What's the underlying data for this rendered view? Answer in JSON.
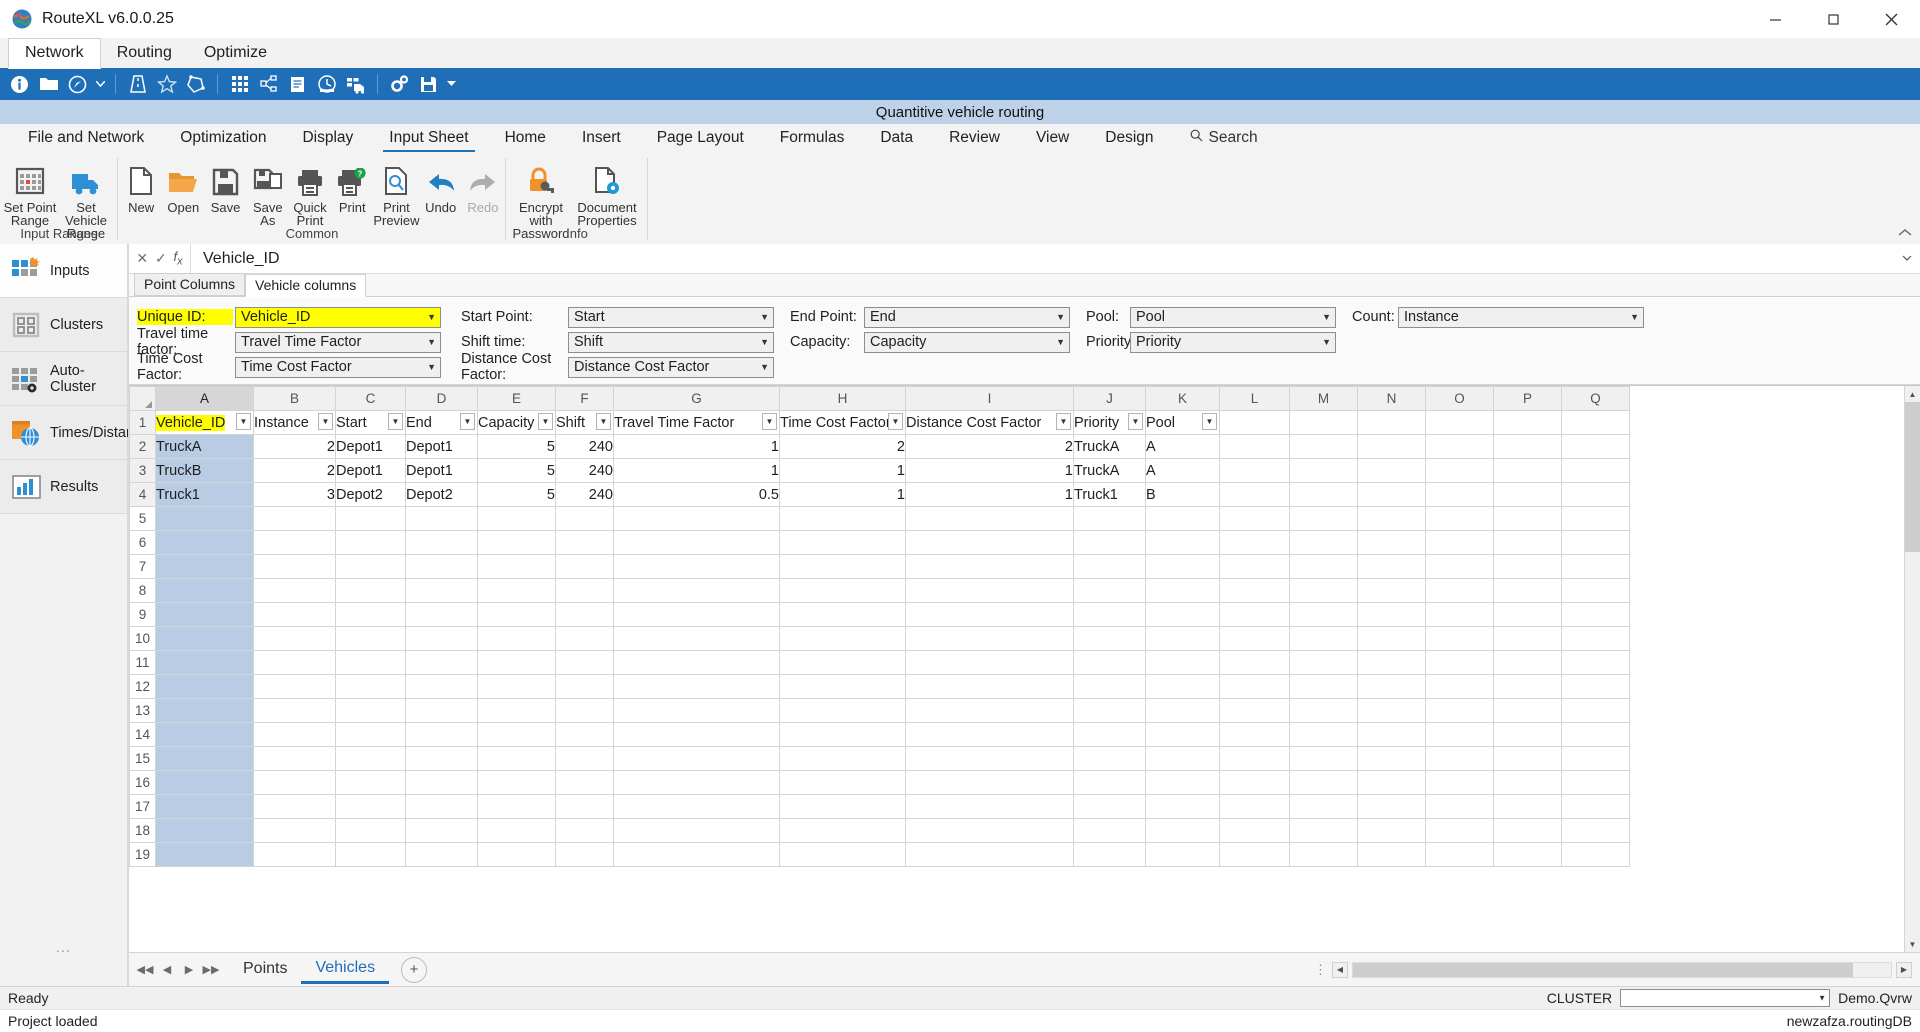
{
  "window": {
    "title": "RouteXL v6.0.0.25",
    "icon": "app-globe-icon",
    "minimize": "minimize",
    "maximize": "maximize",
    "close": "close"
  },
  "menubar": {
    "items": [
      {
        "label": "Network",
        "active": true
      },
      {
        "label": "Routing",
        "active": false
      },
      {
        "label": "Optimize",
        "active": false
      }
    ]
  },
  "quickbar": {
    "icons": [
      "info-icon",
      "folder-icon",
      "compass-icon",
      "chevron-down-icon",
      "road-icon",
      "star-icon",
      "polygon-icon",
      "matrix-icon",
      "network-nodes-icon",
      "report-icon",
      "clock-icon",
      "truck-list-icon",
      "settings-gears-icon",
      "save-icon",
      "chevron-down-icon"
    ]
  },
  "document": {
    "band_title": "Quantitive vehicle routing"
  },
  "ribbon": {
    "tabs": [
      {
        "label": "File and Network",
        "active": false
      },
      {
        "label": "Optimization",
        "active": false
      },
      {
        "label": "Display",
        "active": false
      },
      {
        "label": "Input Sheet",
        "active": true
      },
      {
        "label": "Home",
        "active": false
      },
      {
        "label": "Insert",
        "active": false
      },
      {
        "label": "Page Layout",
        "active": false
      },
      {
        "label": "Formulas",
        "active": false
      },
      {
        "label": "Data",
        "active": false
      },
      {
        "label": "Review",
        "active": false
      },
      {
        "label": "View",
        "active": false
      },
      {
        "label": "Design",
        "active": false
      }
    ],
    "search": {
      "label": "Search",
      "icon": "search-icon"
    },
    "groups": [
      {
        "name": "Input Ranges",
        "commands": [
          {
            "label": "Set Point\nRange",
            "icon": "point-range-grid-icon",
            "disabled": false
          },
          {
            "label": "Set Vehicle\nRange",
            "icon": "truck-icon",
            "disabled": false
          }
        ]
      },
      {
        "name": "Common",
        "commands": [
          {
            "label": "New",
            "icon": "new-document-icon",
            "disabled": false
          },
          {
            "label": "Open",
            "icon": "open-folder-icon",
            "disabled": false
          },
          {
            "label": "Save",
            "icon": "floppy-save-icon",
            "disabled": false
          },
          {
            "label": "Save As",
            "icon": "save-as-icon",
            "disabled": false
          },
          {
            "label": "Quick\nPrint",
            "icon": "quick-print-icon",
            "disabled": false
          },
          {
            "label": "Print",
            "icon": "print-help-icon",
            "disabled": false
          },
          {
            "label": "Print\nPreview",
            "icon": "print-preview-icon",
            "disabled": false
          },
          {
            "label": "Undo",
            "icon": "undo-arrow-icon",
            "disabled": false
          },
          {
            "label": "Redo",
            "icon": "redo-arrow-icon",
            "disabled": true
          }
        ]
      },
      {
        "name": "Info",
        "commands": [
          {
            "label": "Encrypt with\nPassword",
            "icon": "padlock-key-icon",
            "disabled": false
          },
          {
            "label": "Document\nProperties",
            "icon": "document-gear-icon",
            "disabled": false
          }
        ]
      }
    ],
    "collapse_icon": "chevron-up-icon"
  },
  "sidebar": {
    "items": [
      {
        "label": "Inputs",
        "icon": "inputs-grid-icon",
        "active": true
      },
      {
        "label": "Clusters",
        "icon": "clusters-grid-icon",
        "active": false
      },
      {
        "label": "Auto-Cluster",
        "icon": "auto-cluster-icon",
        "active": false
      },
      {
        "label": "Times/Distances",
        "icon": "times-distances-globe-icon",
        "active": false
      },
      {
        "label": "Results",
        "icon": "results-chart-icon",
        "active": false
      }
    ],
    "overflow": "..."
  },
  "formula_bar": {
    "cancel_icon": "cancel-x-icon",
    "confirm_icon": "confirm-check-icon",
    "function_icon": "fx-icon",
    "value": "Vehicle_ID",
    "expand_icon": "chevron-down-icon"
  },
  "column_tabs": [
    {
      "label": "Point Columns",
      "active": false
    },
    {
      "label": "Vehicle columns",
      "active": true
    }
  ],
  "mapping_form": {
    "fields": [
      {
        "label": "Unique ID:",
        "value": "Vehicle_ID",
        "highlighted": true,
        "type": "combo"
      },
      {
        "label": "Start Point:",
        "value": "Start",
        "highlighted": false,
        "type": "combo"
      },
      {
        "label": "End Point:",
        "value": "End",
        "highlighted": false,
        "type": "combo"
      },
      {
        "label": "Pool:",
        "value": "Pool",
        "highlighted": false,
        "type": "combo"
      },
      {
        "label": "Count:",
        "value": "Instance",
        "highlighted": false,
        "type": "combo"
      },
      {
        "label": "Travel time factor:",
        "value": "Travel Time Factor",
        "highlighted": false,
        "type": "combo"
      },
      {
        "label": "Shift time:",
        "value": "Shift",
        "highlighted": false,
        "type": "combo"
      },
      {
        "label": "Capacity:",
        "value": "Capacity",
        "highlighted": false,
        "type": "combo"
      },
      {
        "label": "Priority",
        "value": "Priority",
        "highlighted": false,
        "type": "combo"
      },
      {
        "label": "Time Cost Factor:",
        "value": "Time Cost Factor",
        "highlighted": false,
        "type": "combo"
      },
      {
        "label": "Distance Cost Factor:",
        "value": "Distance Cost Factor",
        "highlighted": false,
        "type": "combo"
      }
    ]
  },
  "sheet": {
    "column_letters": [
      "A",
      "B",
      "C",
      "D",
      "E",
      "F",
      "G",
      "H",
      "I",
      "J",
      "K",
      "L",
      "M",
      "N",
      "O",
      "P",
      "Q"
    ],
    "headers": [
      "Vehicle_ID",
      "Instance",
      "Start",
      "End",
      "Capacity",
      "Shift",
      "Travel Time Factor",
      "Time Cost Factor",
      "Distance Cost Factor",
      "Priority",
      "Pool",
      "",
      "",
      "",
      "",
      "",
      ""
    ],
    "header_row_number": "1",
    "rows": [
      {
        "n": "2",
        "cells": [
          "TruckA",
          "2",
          "Depot1",
          "Depot1",
          "5",
          "240",
          "1",
          "2",
          "2",
          "TruckA",
          "A",
          "",
          "",
          "",
          "",
          "",
          ""
        ]
      },
      {
        "n": "3",
        "cells": [
          "TruckB",
          "2",
          "Depot1",
          "Depot1",
          "5",
          "240",
          "1",
          "1",
          "1",
          "TruckA",
          "A",
          "",
          "",
          "",
          "",
          "",
          ""
        ]
      },
      {
        "n": "4",
        "cells": [
          "Truck1",
          "3",
          "Depot2",
          "Depot2",
          "5",
          "240",
          "0.5",
          "1",
          "1",
          "Truck1",
          "B",
          "",
          "",
          "",
          "",
          "",
          ""
        ]
      }
    ],
    "empty_row_numbers": [
      "5",
      "6",
      "7",
      "8",
      "9",
      "10",
      "11",
      "12",
      "13",
      "14",
      "15",
      "16",
      "17",
      "18",
      "19"
    ],
    "numeric_columns": [
      1,
      4,
      5,
      6,
      7,
      8
    ],
    "selected_column": "A"
  },
  "sheet_tabs": {
    "nav_first": "first-sheet-icon",
    "nav_prev": "prev-sheet-icon",
    "nav_next": "next-sheet-icon",
    "nav_last": "last-sheet-icon",
    "tabs": [
      {
        "label": "Points",
        "active": false
      },
      {
        "label": "Vehicles",
        "active": true
      }
    ],
    "add_label": "+"
  },
  "status": {
    "ready": "Ready",
    "cluster_label": "CLUSTER",
    "cluster_value": "",
    "file": "Demo.Qvrw",
    "message": "Project loaded",
    "database": "newzafza.routingDB"
  },
  "colors": {
    "accent_blue": "#1e6fb8",
    "band_blue": "#bdd2e8",
    "highlight_yellow": "#ffff00",
    "selection_blue": "#b8cce4",
    "orange": "#f0922b"
  }
}
